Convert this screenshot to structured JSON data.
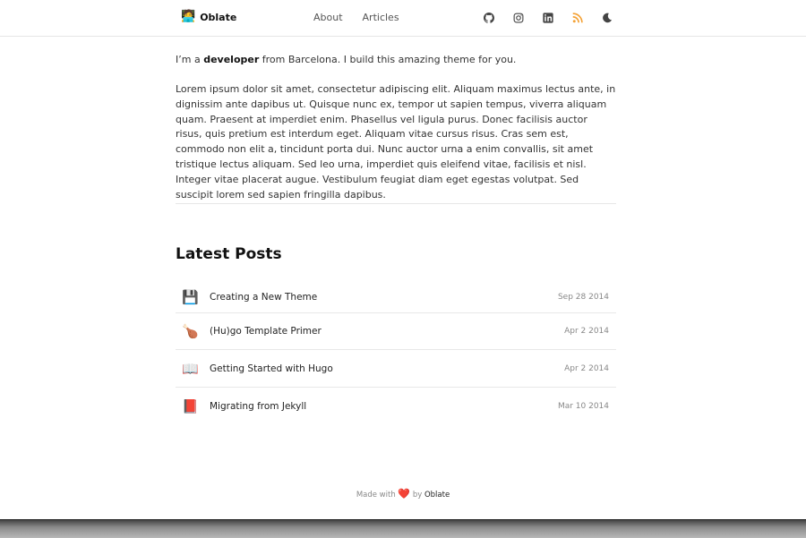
{
  "header": {
    "brand_emoji": "🧑‍💻",
    "brand_name": "Oblate",
    "nav": [
      {
        "label": "About"
      },
      {
        "label": "Articles"
      }
    ],
    "social_icons": [
      "github-icon",
      "instagram-icon",
      "linkedin-icon",
      "rss-icon",
      "moon-icon"
    ],
    "rss_color": "#f4a236"
  },
  "intro": {
    "prefix": "I’m a ",
    "bold": "developer",
    "suffix": " from Barcelona. I build this amazing theme for you."
  },
  "lorem": "Lorem ipsum dolor sit amet, consectetur adipiscing elit. Aliquam maximus lectus ante, in dignissim ante dapibus ut. Quisque nunc ex, tempor ut sapien tempus, viverra aliquam quam. Praesent at imperdiet enim. Phasellus vel ligula purus. Donec facilisis auctor risus, quis pretium est interdum eget. Aliquam vitae cursus risus. Cras sem est, commodo non elit a, tincidunt porta dui. Nunc auctor urna a enim convallis, sit amet tristique lectus aliquam. Sed leo urna, imperdiet quis eleifend vitae, facilisis et nisl. Integer vitae placerat augue. Vestibulum feugiat diam eget egestas volutpat. Sed suscipit lorem sed sapien fringilla dapibus.",
  "latest": {
    "title": "Latest Posts",
    "posts": [
      {
        "emoji": "💾",
        "title": "Creating a New Theme",
        "date": "Sep 28 2014"
      },
      {
        "emoji": "🍗",
        "title": "(Hu)go Template Primer",
        "date": "Apr 2 2014"
      },
      {
        "emoji": "📖",
        "title": "Getting Started with Hugo",
        "date": "Apr 2 2014"
      },
      {
        "emoji": "📕",
        "title": "Migrating from Jekyll",
        "date": "Mar 10 2014"
      }
    ]
  },
  "footer": {
    "made_with": "Made with",
    "heart": "❤️",
    "by": "by",
    "link": "Oblate"
  }
}
